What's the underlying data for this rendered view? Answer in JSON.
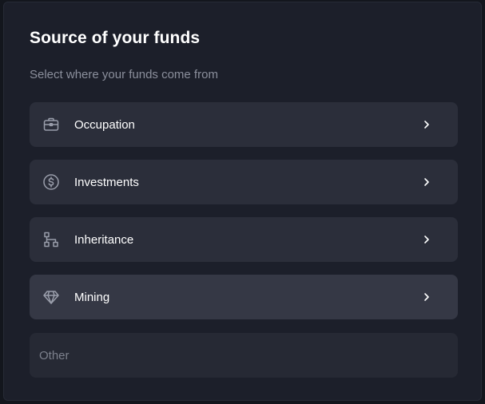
{
  "header": {
    "title": "Source of your funds",
    "subtitle": "Select where your funds come from"
  },
  "options": [
    {
      "label": "Occupation",
      "icon": "briefcase-icon"
    },
    {
      "label": "Investments",
      "icon": "dollar-coin-icon"
    },
    {
      "label": "Inheritance",
      "icon": "hierarchy-icon"
    },
    {
      "label": "Mining",
      "icon": "diamond-icon"
    }
  ],
  "other": {
    "placeholder": "Other",
    "value": ""
  },
  "colors": {
    "background": "#1c1f2a",
    "card": "#2b2e3a",
    "card_hover": "#353845",
    "text_primary": "#ffffff",
    "text_secondary": "#8b8f9c",
    "icon": "#9a9eab"
  }
}
